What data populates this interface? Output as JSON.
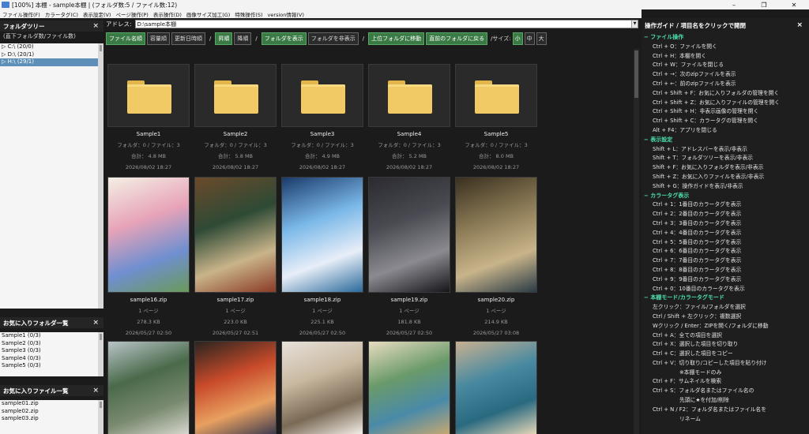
{
  "window": {
    "title": "[100%] 本棚 - sample本棚 | (フォルダ数:5 / ファイル数:12)",
    "buttons": [
      "–",
      "❐",
      "✕"
    ]
  },
  "menu": [
    "ファイル操作(F)",
    "カラータグ(C)",
    "表示設定(V)",
    "ページ操作(P)",
    "表示操作(D)",
    "画像サイズ加工(G)",
    "特殊操作(S)",
    "version情報(V)"
  ],
  "folder_tree": {
    "title": "フォルダツリー",
    "subtitle": "(直下フォルダ数/ファイル数)",
    "items": [
      "C:\\ (20/0)",
      "D:\\ (20/1)",
      "H:\\ (29/1)"
    ]
  },
  "fav_folders": {
    "title": "お気に入りフォルダ一覧",
    "items": [
      "Sample1 (0/3)",
      "Sample2 (0/3)",
      "Sample3 (0/3)",
      "Sample4 (0/3)",
      "Sample5 (0/3)"
    ]
  },
  "fav_files": {
    "title": "お気に入りファイル一覧",
    "items": [
      "sample01.zip",
      "sample02.zip",
      "sample03.zip"
    ]
  },
  "address": {
    "label": "アドレス:",
    "value": "D:\\sample本棚"
  },
  "toolbar": {
    "sort": [
      "ファイル名順",
      "容量順",
      "更新日時順"
    ],
    "order": [
      "昇順",
      "降順"
    ],
    "folder_show": "フォルダを表示",
    "folder_hide": "フォルダを非表示",
    "up": "上位フォルダに移動",
    "back": "直前のフォルダに戻る",
    "size_label": "/サイズ:",
    "sizes": [
      "小",
      "中",
      "大"
    ],
    "separator": "/"
  },
  "folders": [
    {
      "name": "Sample1",
      "info": "フォルダ：0 / ファイル：3",
      "total": "合計： 4.8 MB",
      "date": "2026/08/02 18:27"
    },
    {
      "name": "Sample2",
      "info": "フォルダ：0 / ファイル：3",
      "total": "合計： 5.8 MB",
      "date": "2026/08/02 18:27"
    },
    {
      "name": "Sample3",
      "info": "フォルダ：0 / ファイル：3",
      "total": "合計： 4.9 MB",
      "date": "2026/08/02 18:27"
    },
    {
      "name": "Sample4",
      "info": "フォルダ：0 / ファイル：3",
      "total": "合計： 5.2 MB",
      "date": "2026/08/02 18:27"
    },
    {
      "name": "Sample5",
      "info": "フォルダ：0 / ファイル：3",
      "total": "合計： 8.0 MB",
      "date": "2026/08/02 18:27"
    }
  ],
  "files": [
    {
      "name": "sample16.zip",
      "pages": "1 ページ",
      "size": "278.3 KB",
      "date": "2026/05/27 02:50",
      "palette": [
        "#f4efe4",
        "#e7a3b8",
        "#6f8fd0",
        "#6a9a5a"
      ]
    },
    {
      "name": "sample17.zip",
      "pages": "1 ページ",
      "size": "223.0 KB",
      "date": "2026/05/27 02:51",
      "palette": [
        "#6b4a2a",
        "#2e4a35",
        "#c9b48a",
        "#8a3a25"
      ]
    },
    {
      "name": "sample18.zip",
      "pages": "1 ページ",
      "size": "225.1 KB",
      "date": "2026/05/27 02:50",
      "palette": [
        "#1a3a6a",
        "#7ab8e8",
        "#e8eef8",
        "#2a6a9a"
      ]
    },
    {
      "name": "sample19.zip",
      "pages": "1 ページ",
      "size": "181.8 KB",
      "date": "2026/05/27 02:50",
      "palette": [
        "#2a2a30",
        "#4a4a52",
        "#8a8a90",
        "#15151a"
      ]
    },
    {
      "name": "sample20.zip",
      "pages": "1 ページ",
      "size": "214.9 KB",
      "date": "2026/05/27 03:08",
      "palette": [
        "#3a3020",
        "#8a7a55",
        "#c8b48a",
        "#2a3a45"
      ]
    },
    {
      "palette": [
        "#b8c4c8",
        "#4a6a4a",
        "#7a8a70",
        "#d8d8d0"
      ]
    },
    {
      "palette": [
        "#2a2420",
        "#c84a2a",
        "#e8a060",
        "#3a3a50"
      ]
    },
    {
      "palette": [
        "#e8e2da",
        "#c8b8a0",
        "#7a6a55",
        "#f4f0ea"
      ]
    },
    {
      "palette": [
        "#e8dcc0",
        "#6a9a6a",
        "#4a8aa8",
        "#c8a870"
      ]
    },
    {
      "palette": [
        "#c8b090",
        "#4a8aa0",
        "#2a6a80",
        "#e8d8b8"
      ]
    }
  ],
  "guide": {
    "title": "操作ガイド / 項目名をクリックで開閉",
    "sections": [
      {
        "name": "− ファイル操作",
        "items": [
          "Ctrl + O：ファイルを開く",
          "Ctrl + H：本棚を開く",
          "Ctrl + W：ファイルを閉じる",
          "Ctrl + →：次のzipファイルを表示",
          "Ctrl + ←：前のzipファイルを表示",
          "Ctrl + Shift + F：お気に入りフォルダの管理を開く",
          "Ctrl + Shift + Z：お気に入りファイルの管理を開く",
          "Ctrl + Shift + H：非表示画像の管理を開く",
          "Ctrl + Shift + C：カラータグの管理を開く",
          "Alt + F4：アプリを閉じる"
        ]
      },
      {
        "name": "− 表示設定",
        "items": [
          "Shift + L：アドレスバーを表示/非表示",
          "Shift + T：フォルダツリーを表示/非表示",
          "Shift + F：お気に入りフォルダを表示/非表示",
          "Shift + Z：お気に入りファイルを表示/非表示",
          "Shift + G：操作ガイドを表示/非表示"
        ]
      },
      {
        "name": "− カラータグ表示",
        "items": [
          "Ctrl + 1：1番目のカラータグを表示",
          "Ctrl + 2：2番目のカラータグを表示",
          "Ctrl + 3：3番目のカラータグを表示",
          "Ctrl + 4：4番目のカラータグを表示",
          "Ctrl + 5：5番目のカラータグを表示",
          "Ctrl + 6：6番目のカラータグを表示",
          "Ctrl + 7：7番目のカラータグを表示",
          "Ctrl + 8：8番目のカラータグを表示",
          "Ctrl + 9：9番目のカラータグを表示",
          "Ctrl + 0：10番目のカラータグを表示"
        ]
      },
      {
        "name": "− 本棚モード/カラータグモード",
        "items": [
          "左クリック：ファイル/フォルダを選択",
          "Ctrl / Shift + 左クリック：複数選択",
          "Wクリック / Enter：ZIPを開く/フォルダに移動",
          "Ctrl + A：全ての項目を選択",
          "Ctrl + X：選択した項目を切り取り",
          "Ctrl + C：選択した項目をコピー",
          "Ctrl + V：切り取り/コピーした項目を貼り付け",
          "　　　　　※本棚モードのみ",
          "Ctrl + F：サムネイルを検索",
          "Ctrl + S：フォルダ名またはファイル名の",
          "　　　　　先頭に★を付加/削除",
          "Ctrl + N / F2：フォルダ名またはファイル名を",
          "　　　　　リネーム"
        ]
      }
    ]
  }
}
